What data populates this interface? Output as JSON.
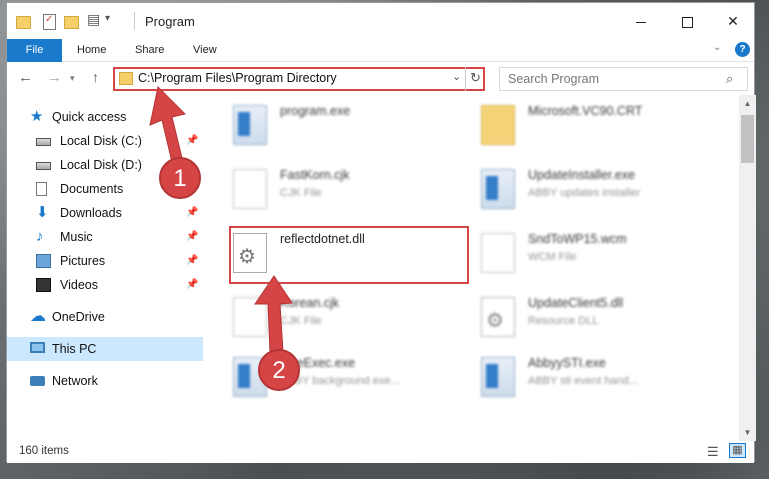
{
  "window": {
    "title": "Program",
    "tabs": {
      "file": "File",
      "home": "Home",
      "share": "Share",
      "view": "View"
    }
  },
  "address": {
    "path": "C:\\Program Files\\Program Directory",
    "search_placeholder": "Search Program"
  },
  "sidebar": {
    "items": [
      {
        "label": "Quick access",
        "icon": "star-icon",
        "pinned": false
      },
      {
        "label": "Local Disk (C:)",
        "icon": "disk-icon",
        "pinned": true
      },
      {
        "label": "Local Disk (D:)",
        "icon": "disk-icon",
        "pinned": false
      },
      {
        "label": "Documents",
        "icon": "documents-icon",
        "pinned": false
      },
      {
        "label": "Downloads",
        "icon": "download-icon",
        "pinned": true
      },
      {
        "label": "Music",
        "icon": "music-icon",
        "pinned": true
      },
      {
        "label": "Pictures",
        "icon": "pictures-icon",
        "pinned": true
      },
      {
        "label": "Videos",
        "icon": "videos-icon",
        "pinned": true
      },
      {
        "label": "OneDrive",
        "icon": "onedrive-icon",
        "pinned": false
      },
      {
        "label": "This PC",
        "icon": "pc-icon",
        "pinned": false,
        "selected": true
      },
      {
        "label": "Network",
        "icon": "network-icon",
        "pinned": false
      }
    ]
  },
  "files": [
    {
      "name": "program.exe",
      "type": "",
      "icon": "exe-icon"
    },
    {
      "name": "Microsoft.VC90.CRT",
      "type": "",
      "icon": "folder-doc-icon"
    },
    {
      "name": "FastKorn.cjk",
      "type": "CJK File",
      "icon": "document-icon"
    },
    {
      "name": "UpdateInstaller.exe",
      "type": "ABBY updates installer",
      "icon": "exe-icon"
    },
    {
      "name": "reflectdotnet.dll",
      "type": "",
      "icon": "dll-gear-icon"
    },
    {
      "name": "SndToWP15.wcm",
      "type": "WCM File",
      "icon": "document-icon"
    },
    {
      "name": "Korean.cjk",
      "type": "CJK File",
      "icon": "document-icon"
    },
    {
      "name": "UpdateClient5.dll",
      "type": "Resource DLL",
      "icon": "dll-gear-icon"
    },
    {
      "name": "OneExec.exe",
      "type": "ABBY background exe...",
      "icon": "exe-icon"
    },
    {
      "name": "AbbyySTI.exe",
      "type": "ABBY sti event hand...",
      "icon": "exe-icon"
    }
  ],
  "status": {
    "item_count": "160 items"
  },
  "annotations": {
    "step1": "1",
    "step2": "2"
  },
  "colors": {
    "accent": "#1979ca",
    "highlight": "#d64545",
    "selection": "#cce8ff"
  }
}
